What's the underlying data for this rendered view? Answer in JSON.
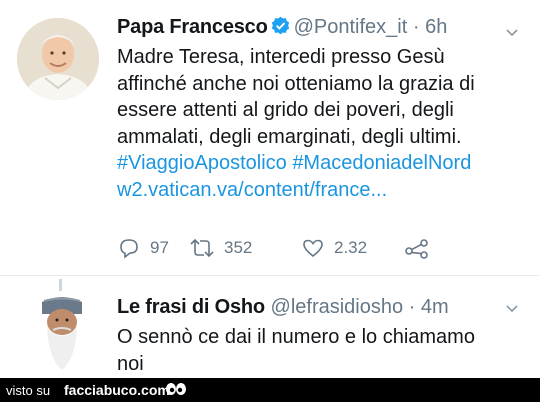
{
  "tweets": [
    {
      "name": "Papa Francesco",
      "handle": "@Pontifex_it",
      "time": "· 6h",
      "lines": [
        "Madre Teresa, intercedi presso Gesù",
        "affinché anche noi otteniamo la grazia di",
        "essere attenti al grido dei poveri, degli",
        "ammalati, degli emarginati, degli ultimi."
      ],
      "hashtags": "#ViaggioApostolico #MacedoniadelNord",
      "link": "w2.vatican.va/content/france...",
      "replies": "97",
      "retweets": "352",
      "likes": "2.32"
    },
    {
      "name": "Le frasi di Osho",
      "handle": "@lefrasidiosho",
      "time": "· 4m",
      "lines": [
        "O sennò ce dai il numero e lo chiamamo",
        "noi"
      ]
    }
  ],
  "footer": {
    "visto_su": "visto su",
    "brand": "facciabuco.com"
  },
  "colors": {
    "link": "#1b95e0",
    "muted": "#657786",
    "verified": "#1da1f2"
  }
}
